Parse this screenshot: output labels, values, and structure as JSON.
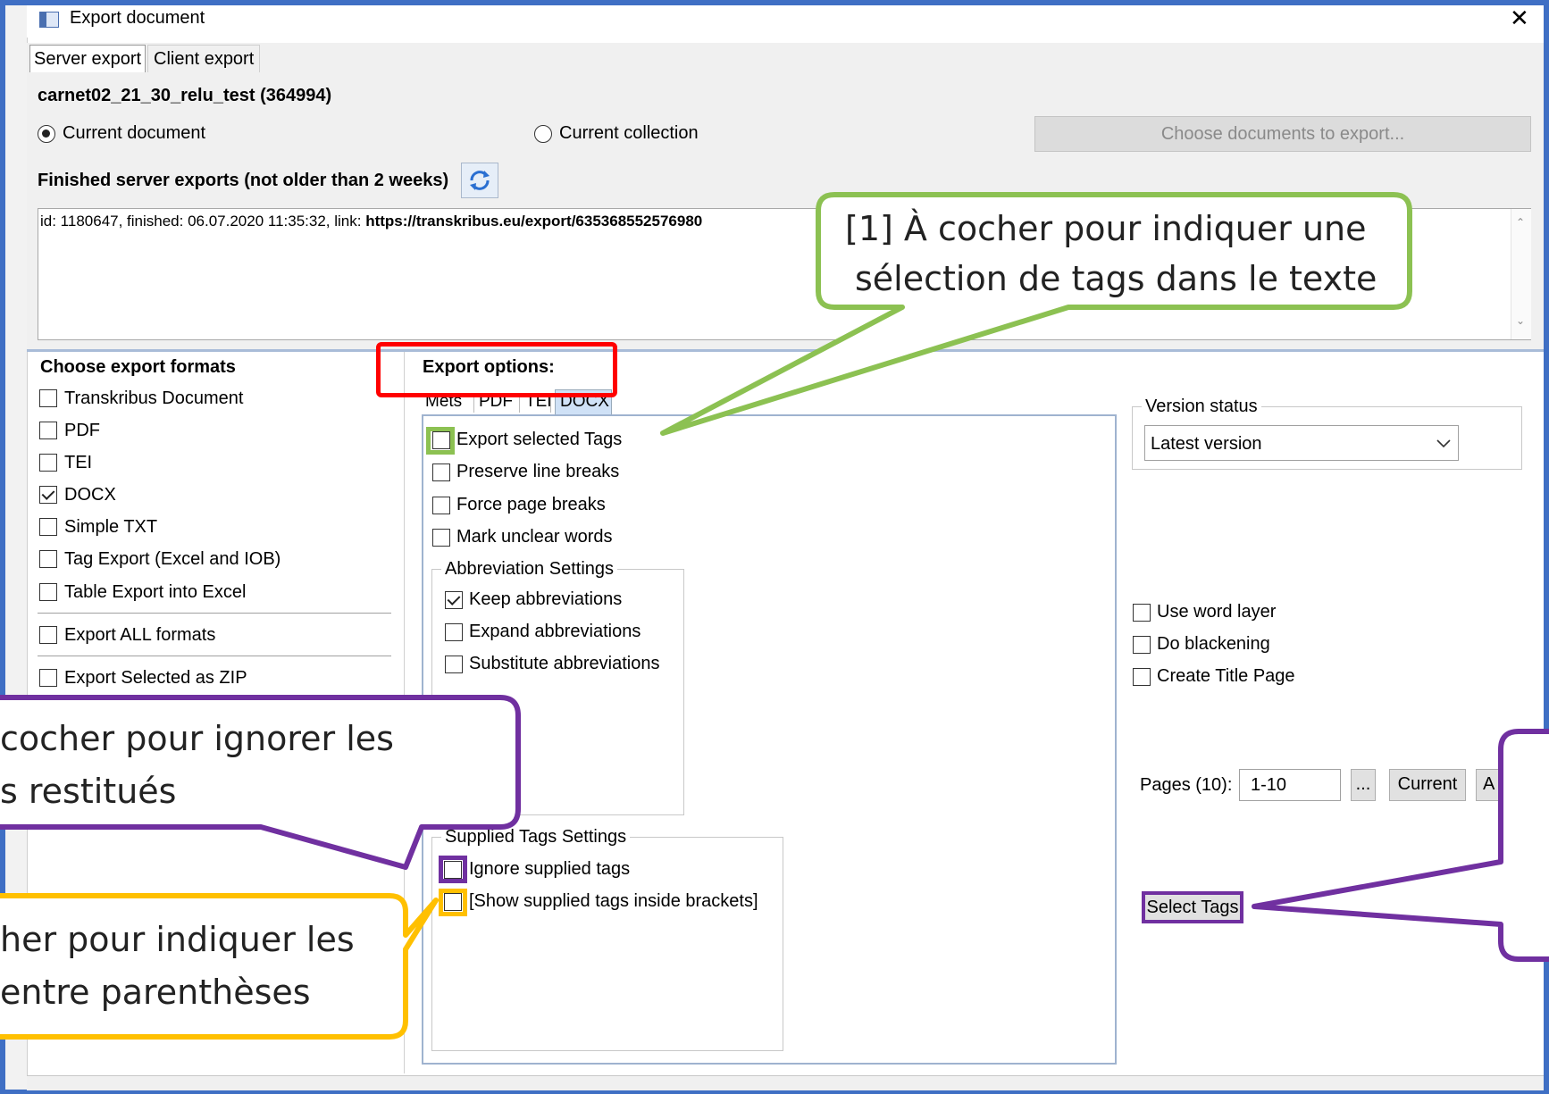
{
  "window": {
    "title": "Export document",
    "close_glyph": "✕"
  },
  "tabs": [
    {
      "label": "Server export",
      "active": true
    },
    {
      "label": "Client export",
      "active": false
    }
  ],
  "document": {
    "name": "carnet02_21_30_relu_test (364994)",
    "radio_current_document": "Current document",
    "radio_current_collection": "Current collection",
    "choose_docs_button": "Choose documents to export..."
  },
  "finished": {
    "heading": "Finished server exports (not older than 2 weeks)",
    "log_prefix": "id: 1180647, finished: 06.07.2020 11:35:32, link: ",
    "log_link": "https://transkribus.eu/export/635368552576980"
  },
  "formats": {
    "heading": "Choose export formats",
    "items": [
      {
        "label": "Transkribus Document",
        "checked": false
      },
      {
        "label": "PDF",
        "checked": false
      },
      {
        "label": "TEI",
        "checked": false
      },
      {
        "label": "DOCX",
        "checked": true
      },
      {
        "label": "Simple TXT",
        "checked": false
      },
      {
        "label": "Tag Export (Excel and IOB)",
        "checked": false
      },
      {
        "label": "Table Export into Excel",
        "checked": false
      }
    ],
    "export_all": "Export ALL formats",
    "export_zip": "Export Selected as ZIP"
  },
  "options": {
    "heading": "Export options:",
    "subtabs": [
      "Mets",
      "PDF",
      "TEI",
      "DOCX"
    ],
    "active_subtab": "DOCX",
    "docx": [
      {
        "label": "Export selected Tags",
        "checked": false
      },
      {
        "label": "Preserve line breaks",
        "checked": false
      },
      {
        "label": "Force page breaks",
        "checked": false
      },
      {
        "label": "Mark unclear words",
        "checked": false
      }
    ],
    "abbrev_title": "Abbreviation Settings",
    "abbrev": [
      {
        "label": "Keep abbreviations",
        "checked": true
      },
      {
        "label": "Expand abbreviations",
        "checked": false
      },
      {
        "label": "Substitute abbreviations",
        "checked": false
      }
    ],
    "supplied_title": "Supplied Tags Settings",
    "supplied": [
      {
        "label": "Ignore supplied tags",
        "checked": false
      },
      {
        "label": "[Show supplied tags inside brackets]",
        "checked": false
      }
    ]
  },
  "right": {
    "version_title": "Version status",
    "version_value": "Latest version",
    "checks": [
      {
        "label": "Use word layer",
        "checked": false
      },
      {
        "label": "Do blackening",
        "checked": false
      },
      {
        "label": "Create Title Page",
        "checked": false
      }
    ],
    "pages_label": "Pages (10):",
    "pages_value": "1-10",
    "ellipsis_button": "...",
    "current_button": "Current",
    "partial_button": "A",
    "select_tags": "Select Tags"
  },
  "callouts": {
    "green": [
      "[1] À cocher pour indiquer une",
      "sélection de tags dans le texte"
    ],
    "purple": [
      "cocher pour ignorer les",
      "s restitués"
    ],
    "orange": [
      "her pour indiquer les",
      " entre parenthèses"
    ]
  },
  "colors": {
    "window_border": "#3f6fc4",
    "green": "#8cc152",
    "purple": "#7030a0",
    "orange": "#ffc000",
    "red": "#ff0000",
    "panel_line": "#a9bcd8"
  }
}
